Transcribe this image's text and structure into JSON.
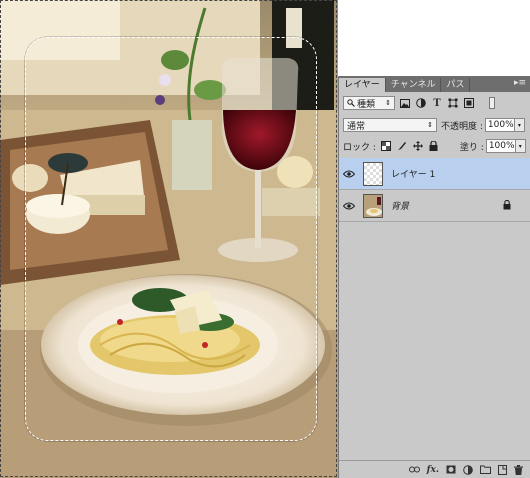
{
  "panel": {
    "tabs": [
      {
        "label": "レイヤー",
        "active": true
      },
      {
        "label": "チャンネル",
        "active": false
      },
      {
        "label": "パス",
        "active": false
      }
    ],
    "menu_glyph": "▸≡",
    "filter": {
      "label": "種類",
      "icons": [
        "image-filter-icon",
        "adjustment-filter-icon",
        "type-filter-icon",
        "shape-filter-icon",
        "smart-object-filter-icon"
      ]
    },
    "blend_mode": "通常",
    "opacity_label": "不透明度 :",
    "opacity_value": "100%",
    "lock_label": "ロック :",
    "fill_label": "塗り :",
    "fill_value": "100%",
    "layers": [
      {
        "name": "レイヤー 1",
        "selected": true,
        "visible": true,
        "locked": false,
        "thumbnail": "transparent"
      },
      {
        "name": "背景",
        "selected": false,
        "visible": true,
        "locked": true,
        "thumbnail": "photo"
      }
    ],
    "footer_icons": [
      "link-layers-icon",
      "fx-icon",
      "layer-mask-icon",
      "adjustment-layer-icon",
      "new-group-icon",
      "new-layer-icon",
      "trash-icon"
    ],
    "fx_label": "fx."
  },
  "colors": {
    "panel_bg": "#c9c9c9",
    "tab_bar": "#6e6e6e",
    "selected_layer": "#b8cfee"
  }
}
